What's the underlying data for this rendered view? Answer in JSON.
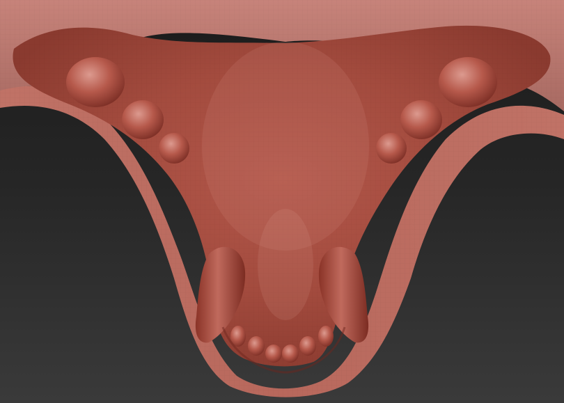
{
  "viewport": {
    "mode": "3d-sculpt-viewport",
    "model": "upper-jaw-palate-sculpt",
    "shading": "matcap-red-clay-wireframe",
    "background": {
      "top": "#1b1b1b",
      "bottom": "#3a3a3a"
    }
  },
  "colors": {
    "clay_light": "#c98478",
    "clay_mid": "#b45a4c",
    "clay_dark": "#7e2f25",
    "clay_highlight": "#e3a79d",
    "rim": "#a8493d"
  }
}
